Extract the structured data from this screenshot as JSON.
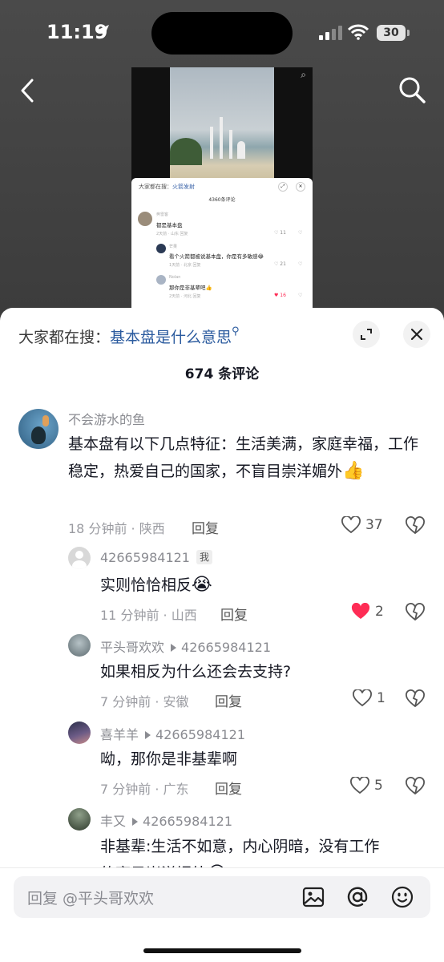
{
  "status_bar": {
    "time": "11:19",
    "battery": "30"
  },
  "preview": {
    "video_more": "⌕",
    "search_prefix": "大家都在搜：",
    "search_term": "火箭发射",
    "comment_count": "4360条评论",
    "rows": [
      {
        "name": "奔雷客",
        "text": "都是基本盘",
        "meta": "2天前 · 山东  回复",
        "likes": "11"
      },
      {
        "name": "芒果",
        "text": "看个火箭都被说基本盘，你是有多敏感😂",
        "meta": "1天前 · 北京  回复",
        "likes": "21"
      },
      {
        "name": "Nolan",
        "text": "那你是非基辈吧👍",
        "meta": "2天前 · 河北  回复",
        "likes": "16"
      }
    ]
  },
  "sheet": {
    "search_prefix": "大家都在搜：",
    "search_term": "基本盘是什么意思",
    "comment_count": "674 条评论",
    "comments": [
      {
        "username": "不会游水的鱼",
        "text": "基本盘有以下几点特征：生活美满，家庭幸福，工作稳定，热爱自己的国家，不盲目崇洋媚外",
        "emoji": "👍",
        "meta": "18 分钟前 · 陕西",
        "reply_label": "回复",
        "likes": "37",
        "liked": false
      },
      {
        "username": "42665984121",
        "badge": "我",
        "text": "实则恰恰相反",
        "emoji": "😭",
        "meta": "11 分钟前 · 山西",
        "reply_label": "回复",
        "likes": "2",
        "liked": true
      },
      {
        "username": "平头哥欢欢",
        "reply_to": "42665984121",
        "text": "如果相反为什么还会去支持?",
        "meta": "7 分钟前 · 安徽",
        "reply_label": "回复",
        "likes": "1",
        "liked": false
      },
      {
        "username": "喜羊羊",
        "reply_to": "42665984121",
        "text": "呦，那你是非基辈啊",
        "meta": "7 分钟前 · 广东",
        "reply_label": "回复",
        "likes": "5",
        "liked": false
      },
      {
        "username": "丰又",
        "reply_to": "42665984121",
        "text": "非基辈:生活不如意，内心阴暗，没有工作",
        "text_cut": "的盲目崇洋媚外",
        "emoji": "😂"
      }
    ]
  },
  "input": {
    "placeholder": "回复 @平头哥欢欢"
  },
  "colors": {
    "like_red": "#fe2c55",
    "search_term_blue": "#2a5a9e"
  }
}
